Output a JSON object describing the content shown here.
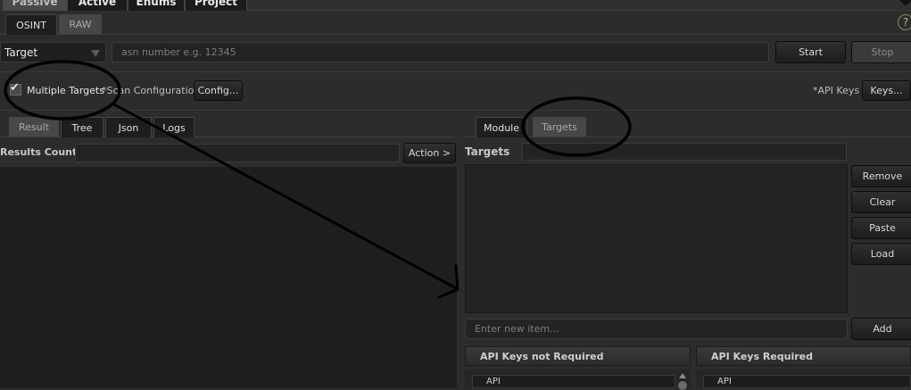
{
  "main_tabs": [
    "Passive",
    "Active",
    "Enums",
    "Project"
  ],
  "sub_tabs": [
    "OSINT",
    "RAW"
  ],
  "help_icon": "?",
  "target": {
    "selected": "Target",
    "placeholder": "asn number e.g. 12345",
    "start_label": "Start",
    "stop_label": "Stop"
  },
  "options": {
    "multiple_targets_label": "Multiple Targets",
    "multiple_targets_checked": true,
    "scan_config_label": "*Scan Configuration",
    "config_button": "Config...",
    "api_keys_label": "*API Keys",
    "keys_button": "Keys..."
  },
  "result_tabs": [
    "Result",
    "Tree",
    "Json",
    "Logs"
  ],
  "results": {
    "count_label": "Results Count:",
    "action_button": "Action >"
  },
  "right_tabs": [
    "Module",
    "Targets"
  ],
  "targets_panel": {
    "label": "Targets",
    "buttons": [
      "Remove",
      "Clear",
      "Paste",
      "Load"
    ],
    "new_item_placeholder": "Enter new item...",
    "add_button": "Add"
  },
  "api_lists": [
    {
      "title": "API Keys not Required",
      "first_row": "API"
    },
    {
      "title": "API Keys Required",
      "first_row": "API"
    }
  ],
  "annotation_color": "#000000"
}
